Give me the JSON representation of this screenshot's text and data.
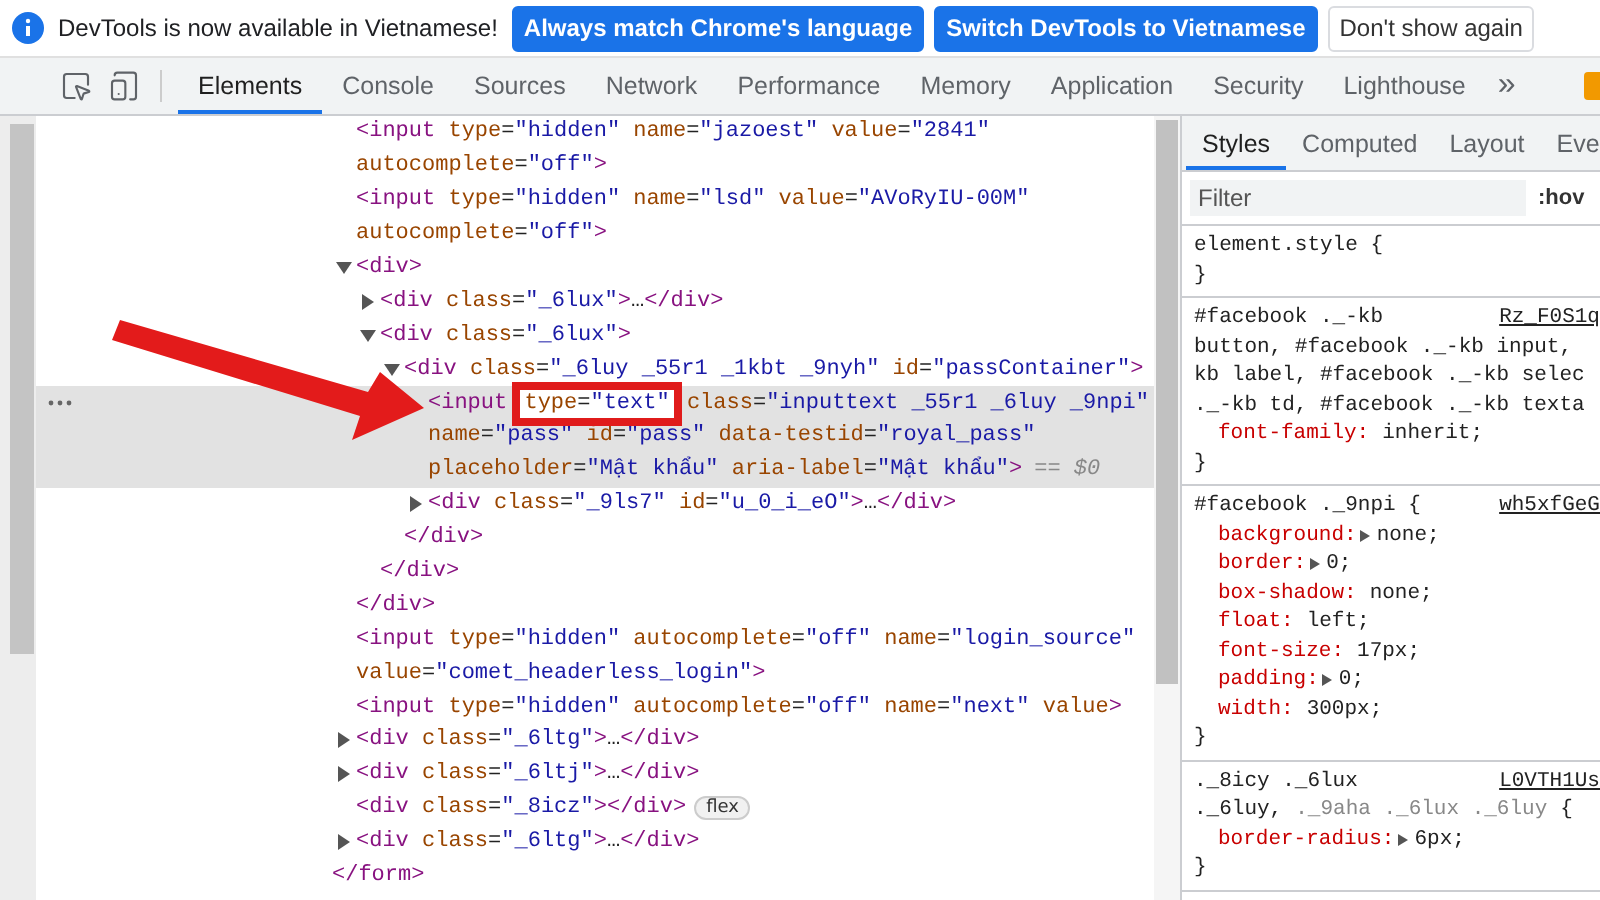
{
  "infobar": {
    "message": "DevTools is now available in Vietnamese!",
    "buttons": [
      {
        "label": "Always match Chrome's language",
        "kind": "primary"
      },
      {
        "label": "Switch DevTools to Vietnamese",
        "kind": "primary"
      },
      {
        "label": "Don't show again",
        "kind": "secondary"
      }
    ]
  },
  "toolbar": {
    "tabs": [
      {
        "label": "Elements",
        "selected": true
      },
      {
        "label": "Console",
        "selected": false
      },
      {
        "label": "Sources",
        "selected": false
      },
      {
        "label": "Network",
        "selected": false
      },
      {
        "label": "Performance",
        "selected": false
      },
      {
        "label": "Memory",
        "selected": false
      },
      {
        "label": "Application",
        "selected": false
      },
      {
        "label": "Security",
        "selected": false
      },
      {
        "label": "Lighthouse",
        "selected": false
      }
    ],
    "overflow": "»"
  },
  "dom_tree": {
    "close": "</form>",
    "children": [
      {
        "lines": [
          "<input type=\"hidden\" name=\"jazoest\" value=\"2841\"",
          "autocomplete=\"off\">"
        ],
        "selected": false
      },
      {
        "lines": [
          "<input type=\"hidden\" name=\"lsd\" value=\"AVoRyIU-00M\"",
          "autocomplete=\"off\">"
        ],
        "selected": false
      },
      {
        "lines": [
          "<div>"
        ],
        "expanded": true,
        "selected": false,
        "close": "</div>",
        "children": [
          {
            "lines": [
              "<div class=\"_6lux\">…</div>"
            ],
            "expanded": false,
            "selected": false
          },
          {
            "lines": [
              "<div class=\"_6lux\">"
            ],
            "expanded": true,
            "selected": false,
            "close": "</div>",
            "children": [
              {
                "lines": [
                  "<div class=\"_6luy _55r1 _1kbt _9nyh\" id=\"passContainer\">"
                ],
                "expanded": true,
                "selected": false,
                "close": "</div>",
                "children": [
                  {
                    "lines": [
                      {
                        "parts": [
                          {
                            "text": "<input "
                          },
                          {
                            "text": "type=\"text\"",
                            "boxed": true
                          },
                          {
                            "text": " class=\"inputtext _55r1 _6luy _9npi\""
                          }
                        ]
                      },
                      "name=\"pass\" id=\"pass\" data-testid=\"royal_pass\"",
                      "placeholder=\"Mật khẩu\" aria-label=\"Mật khẩu\">"
                    ],
                    "selected": true,
                    "suffix": "== $0"
                  },
                  {
                    "lines": [
                      "<div class=\"_9ls7\" id=\"u_0_i_eO\">…</div>"
                    ],
                    "expanded": false,
                    "selected": false
                  }
                ]
              }
            ]
          }
        ]
      },
      {
        "lines": [
          "<input type=\"hidden\" autocomplete=\"off\" name=\"login_source\"",
          "value=\"comet_headerless_login\">"
        ],
        "selected": false
      },
      {
        "lines": [
          "<input type=\"hidden\" autocomplete=\"off\" name=\"next\" value>"
        ],
        "selected": false
      },
      {
        "lines": [
          "<div class=\"_6ltg\">…</div>"
        ],
        "expanded": false,
        "selected": false
      },
      {
        "lines": [
          "<div class=\"_6ltj\">…</div>"
        ],
        "expanded": false,
        "selected": false
      },
      {
        "lines": [
          "<div class=\"_8icz\"></div>"
        ],
        "selected": false,
        "badge": "flex"
      },
      {
        "lines": [
          "<div class=\"_6ltg\">…</div>"
        ],
        "expanded": false,
        "selected": false
      }
    ]
  },
  "styles_pane": {
    "tabs": [
      {
        "label": "Styles",
        "selected": true
      },
      {
        "label": "Computed",
        "selected": false
      },
      {
        "label": "Layout",
        "selected": false
      },
      {
        "label": "Eve",
        "selected": false
      }
    ],
    "filter": {
      "placeholder": "Filter"
    },
    "hov": ":hov",
    "rules": [
      {
        "selector_lines": [
          [
            {
              "text": "element.style {",
              "matched": true
            }
          ]
        ],
        "close": "}"
      },
      {
        "selector_lines": [
          [
            {
              "text": "#facebook ._-kb",
              "matched": true
            }
          ],
          [
            {
              "text": "button, #facebook ._-kb input,",
              "matched": true
            }
          ],
          [
            {
              "text": "kb label, #facebook ._-kb selec",
              "matched": true
            }
          ],
          [
            {
              "text": "._-kb td, #facebook ._-kb texta",
              "matched": true
            }
          ]
        ],
        "source": "Rz_F0S1q",
        "properties": [
          {
            "name": "font-family:",
            "value": "inherit;",
            "expandable": false
          }
        ],
        "close": "}"
      },
      {
        "selector_lines": [
          [
            {
              "text": "#facebook ._9npi {",
              "matched": true
            }
          ]
        ],
        "source": "wh5xfGeG",
        "properties": [
          {
            "name": "background:",
            "value": "none;",
            "expandable": true
          },
          {
            "name": "border:",
            "value": "0;",
            "expandable": true
          },
          {
            "name": "box-shadow:",
            "value": "none;",
            "expandable": false
          },
          {
            "name": "float:",
            "value": "left;",
            "expandable": false
          },
          {
            "name": "font-size:",
            "value": "17px;",
            "expandable": false
          },
          {
            "name": "padding:",
            "value": "0;",
            "expandable": true
          },
          {
            "name": "width:",
            "value": "300px;",
            "expandable": false
          }
        ],
        "close": "}"
      },
      {
        "selector_lines": [
          [
            {
              "text": "._8icy ._6lux",
              "matched": true
            }
          ],
          [
            {
              "text": "._6luy,",
              "matched": true
            },
            {
              "text": "._9aha ._6lux ._6luy",
              "matched": false
            },
            {
              "text": "{",
              "matched": true
            }
          ]
        ],
        "source": "L0VTH1Us",
        "properties": [
          {
            "name": "border-radius:",
            "value": "6px;",
            "expandable": true
          }
        ],
        "close": "}"
      }
    ]
  }
}
